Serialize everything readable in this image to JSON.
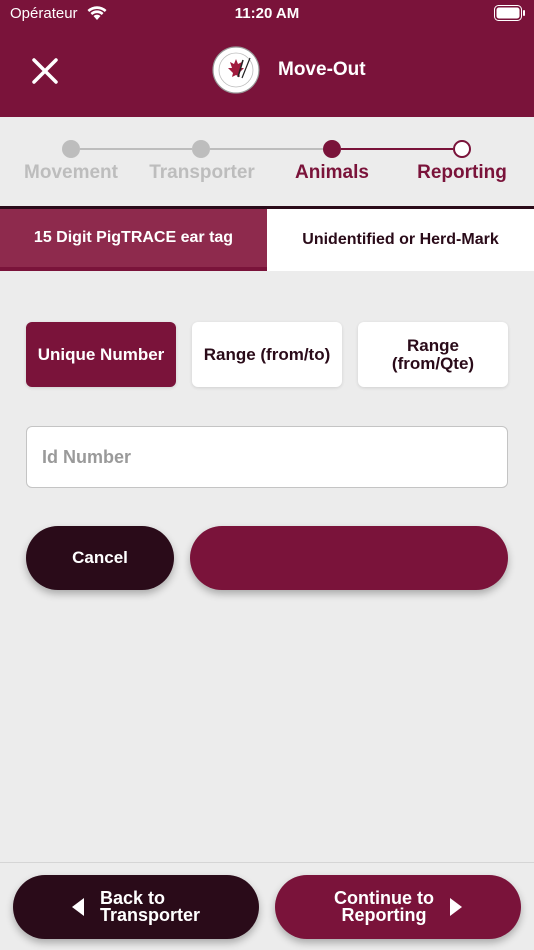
{
  "status_bar": {
    "carrier": "Opérateur",
    "time": "11:20 AM"
  },
  "header": {
    "title": "Move-Out",
    "close_icon": "close-icon",
    "logo": "pigtrace-logo"
  },
  "stepper": {
    "steps": [
      {
        "label": "Movement",
        "state": "completed"
      },
      {
        "label": "Transporter",
        "state": "completed"
      },
      {
        "label": "Animals",
        "state": "current"
      },
      {
        "label": "Reporting",
        "state": "upcoming"
      }
    ]
  },
  "tabs": [
    {
      "label": "15 Digit PigTRACE ear tag",
      "active": true
    },
    {
      "label": "Unidentified or Herd-Mark",
      "active": false
    }
  ],
  "segments": [
    {
      "label": "Unique Number",
      "active": true
    },
    {
      "label": "Range (from/to)",
      "active": false
    },
    {
      "label": "Range (from/Qte)",
      "active": false
    }
  ],
  "id_input": {
    "placeholder": "Id Number",
    "value": ""
  },
  "actions": {
    "cancel_label": "Cancel",
    "confirm_label": ""
  },
  "footer": {
    "back_line1": "Back to",
    "back_line2": "Transporter",
    "next_line1": "Continue to",
    "next_line2": "Reporting"
  },
  "colors": {
    "brand": "#7a133a",
    "dark": "#2a0b19",
    "inactive": "#bdbdbd",
    "background": "#ececec"
  }
}
